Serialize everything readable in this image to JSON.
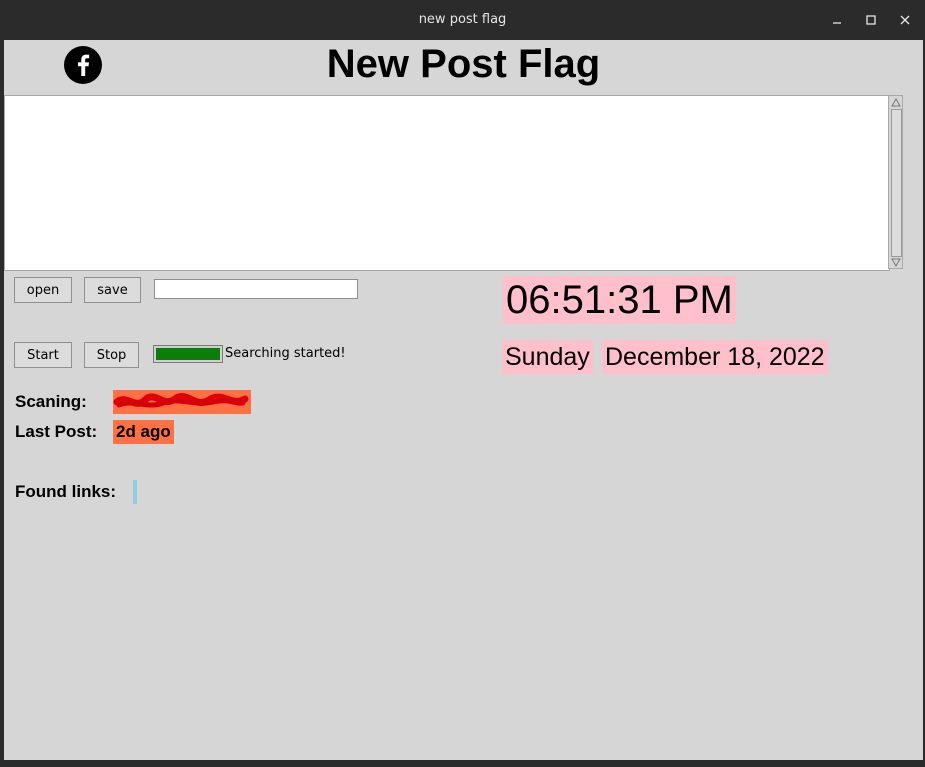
{
  "window": {
    "title": "new post flag"
  },
  "header": {
    "app_title": "New Post Flag",
    "logo_icon": "facebook-icon"
  },
  "file_controls": {
    "open_label": "open",
    "save_label": "save",
    "path_value": ""
  },
  "search_controls": {
    "start_label": "Start",
    "stop_label": "Stop",
    "progress": 1.0,
    "status_text": "Searching started!"
  },
  "info": {
    "scanning_label": "Scaning:",
    "last_post_label": "Last Post:",
    "last_post_value": "2d ago",
    "found_links_label": "Found links:"
  },
  "clock": {
    "time": "06:51:31 PM",
    "weekday": "Sunday",
    "date": "December 18, 2022"
  },
  "colors": {
    "highlight_orange": "#ff7043",
    "clock_pink": "#ffc0cb",
    "progress_green": "#0a7d0a",
    "found_bar": "#8fd0e0"
  }
}
